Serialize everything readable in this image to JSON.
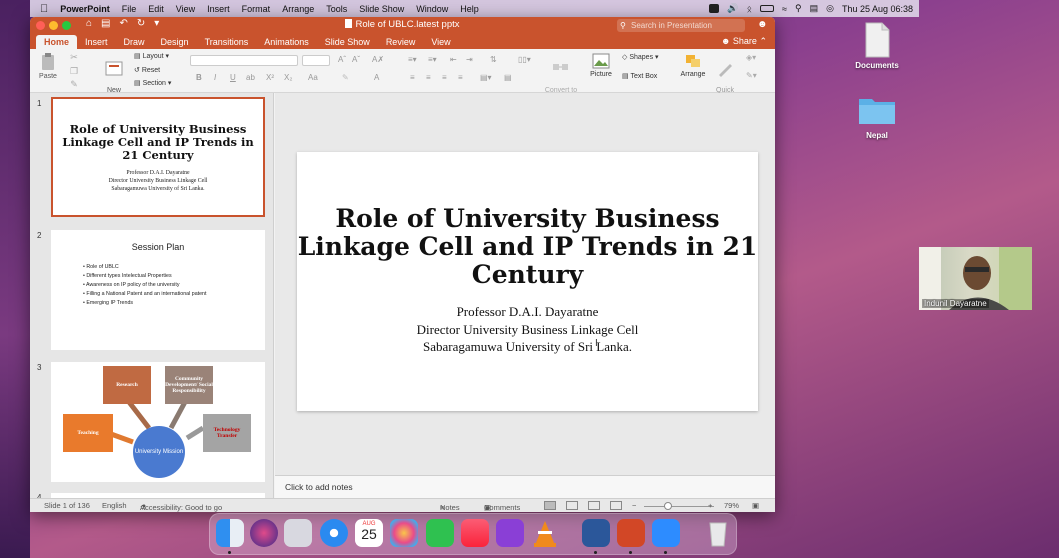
{
  "menubar": {
    "app_name": "PowerPoint",
    "items": [
      "File",
      "Edit",
      "View",
      "Insert",
      "Format",
      "Arrange",
      "Tools",
      "Slide Show",
      "Window",
      "Help"
    ],
    "clock": "Thu 25 Aug  06:38"
  },
  "window": {
    "title": "Role of UBLC.latest pptx",
    "search_placeholder": "Search in Presentation",
    "tabs": [
      "Home",
      "Insert",
      "Draw",
      "Design",
      "Transitions",
      "Animations",
      "Slide Show",
      "Review",
      "View"
    ],
    "active_tab": "Home",
    "share_label": "Share"
  },
  "ribbon": {
    "paste": "Paste",
    "new_slide": "New\nSlide",
    "layout": "Layout",
    "reset": "Reset",
    "section": "Section",
    "convert_smartart": "Convert to\nSmartArt",
    "picture": "Picture",
    "shapes": "Shapes",
    "text_box": "Text Box",
    "arrange": "Arrange",
    "quick_styles": "Quick\nStyles"
  },
  "thumbnails": {
    "slide1": {
      "number": "1",
      "title": "Role of University Business Linkage Cell and IP Trends in 21 Century",
      "lines": [
        "Professor D.A.I. Dayaratne",
        "Director University Business Linkage Cell",
        "Sabaragamuwa University of Sri Lanka."
      ]
    },
    "slide2": {
      "number": "2",
      "title": "Session Plan",
      "bullets": [
        "Role of UBLC",
        "Different types Intelectual Properties",
        "Awareness on IP policy of the university",
        "Filling a National Patent and an international patent",
        "Emerging IP Trends"
      ]
    },
    "slide3": {
      "number": "3",
      "research": "Research",
      "community": "Community Development/ Social Responsibility",
      "teaching": "Teaching",
      "technology": "Technology Transfer",
      "mission": "University Mission"
    },
    "slide4": {
      "number": "4"
    }
  },
  "slide": {
    "title": "Role of University Business Linkage Cell and IP Trends in 21 Century",
    "presenter": "Professor D.A.I. Dayaratne",
    "position": "Director University Business Linkage Cell",
    "university": "Sabaragamuwa University of Sri Lanka."
  },
  "notes_placeholder": "Click to add notes",
  "status": {
    "slide_count": "Slide 1 of 136",
    "language": "English",
    "accessibility": "Accessibility: Good to go",
    "notes": "Notes",
    "comments": "Comments",
    "zoom": "79%"
  },
  "desktop": {
    "documents": "Documents",
    "folder": "Nepal"
  },
  "video": {
    "participant": "Indunil Dayaratne"
  },
  "dock": {
    "calendar_month": "AUG",
    "calendar_day": "25",
    "apps": [
      "finder-icon",
      "siri-icon",
      "launchpad-icon",
      "safari-icon",
      "calendar-icon",
      "photos-icon",
      "facetime-icon",
      "music-icon",
      "podcasts-icon",
      "vlc-icon",
      "word-icon",
      "powerpoint-icon",
      "zoom-icon",
      "trash-icon"
    ]
  },
  "colors": {
    "accent": "#c9532d",
    "dock_bg": "#e6c8e6"
  }
}
